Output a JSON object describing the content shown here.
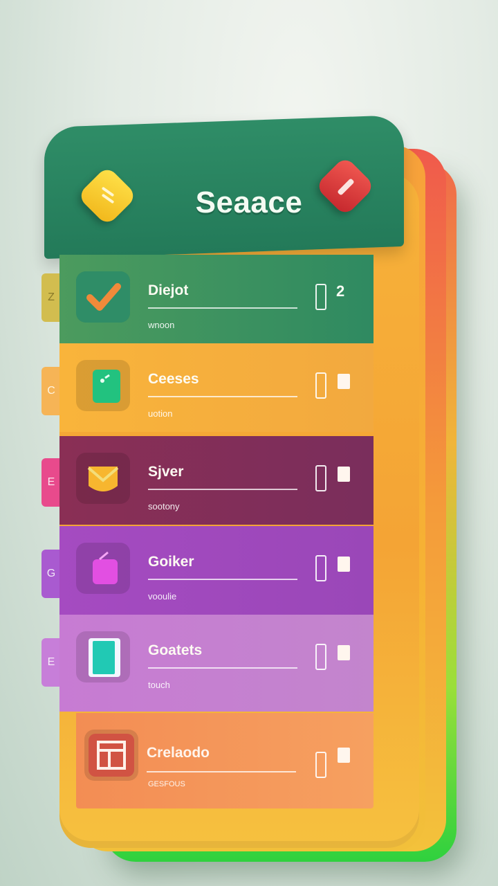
{
  "header": {
    "title": "Seaace",
    "left_icon": "notes-icon",
    "right_icon": "edit-icon"
  },
  "tabs": [
    "Z",
    "C",
    "E",
    "G",
    "E"
  ],
  "rows": [
    {
      "title": "Diejot",
      "subtitle": "wnoon",
      "icon": "checkmark-icon",
      "badge": "2"
    },
    {
      "title": "Ceeses",
      "subtitle": "uotion",
      "icon": "square-app-icon"
    },
    {
      "title": "Sjver",
      "subtitle": "sootony",
      "icon": "shield-icon"
    },
    {
      "title": "Goiker",
      "subtitle": "vooulie",
      "icon": "bag-icon"
    },
    {
      "title": "Goatets",
      "subtitle": "touch",
      "icon": "tablet-icon"
    },
    {
      "title": "Crelaodo",
      "subtitle": "GESFOUS",
      "icon": "box-icon"
    }
  ],
  "colors": {
    "header": "#2f8d67",
    "accent_yellow": "#f1b61a",
    "accent_red": "#c4262c",
    "row_green": "#2f8a61",
    "row_orange": "#f2a93f",
    "row_maroon": "#7a2e5c",
    "row_purple": "#9a47b8",
    "row_lilac": "#c385cd",
    "row_coral": "#f6a060"
  }
}
